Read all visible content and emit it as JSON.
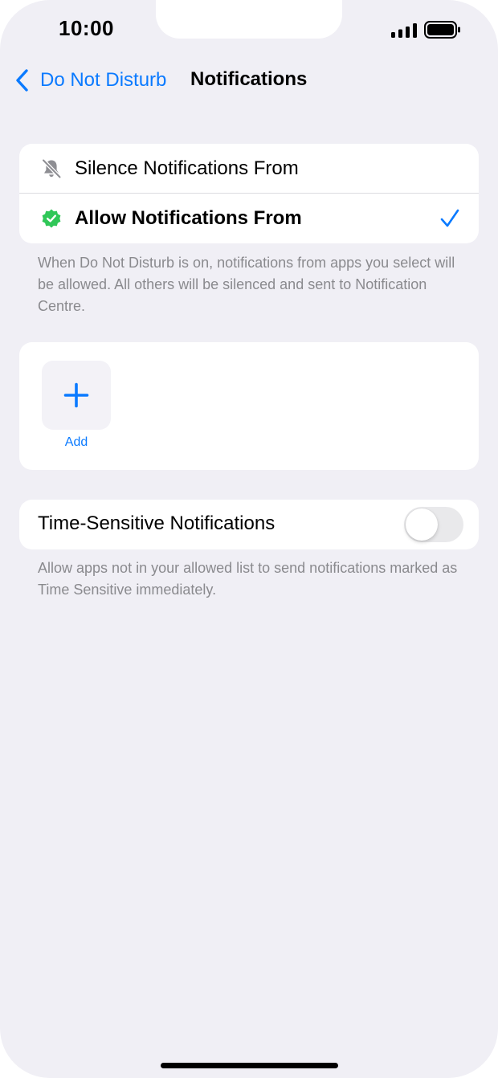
{
  "status_bar": {
    "time": "10:00",
    "signal_icon": "cellular-signal-icon",
    "battery_icon": "battery-full-icon"
  },
  "nav": {
    "back_label": "Do Not Disturb",
    "back_icon": "chevron-left-icon",
    "title": "Notifications"
  },
  "mode_section": {
    "options": [
      {
        "label": "Silence Notifications From",
        "icon": "bell-slash-icon",
        "selected": false
      },
      {
        "label": "Allow Notifications From",
        "icon": "verified-badge-icon",
        "selected": true
      }
    ],
    "footnote": "When Do Not Disturb is on, notifications from apps you select will be allowed. All others will be silenced and sent to Notification Centre."
  },
  "apps_section": {
    "add_label": "Add",
    "add_icon": "plus-icon"
  },
  "time_sensitive": {
    "label": "Time-Sensitive Notifications",
    "enabled": false,
    "footnote": "Allow apps not in your allowed list to send notifications marked as Time Sensitive immediately."
  },
  "colors": {
    "accent": "#0a7aff",
    "badge_green": "#30c758",
    "background": "#f0eff5"
  }
}
